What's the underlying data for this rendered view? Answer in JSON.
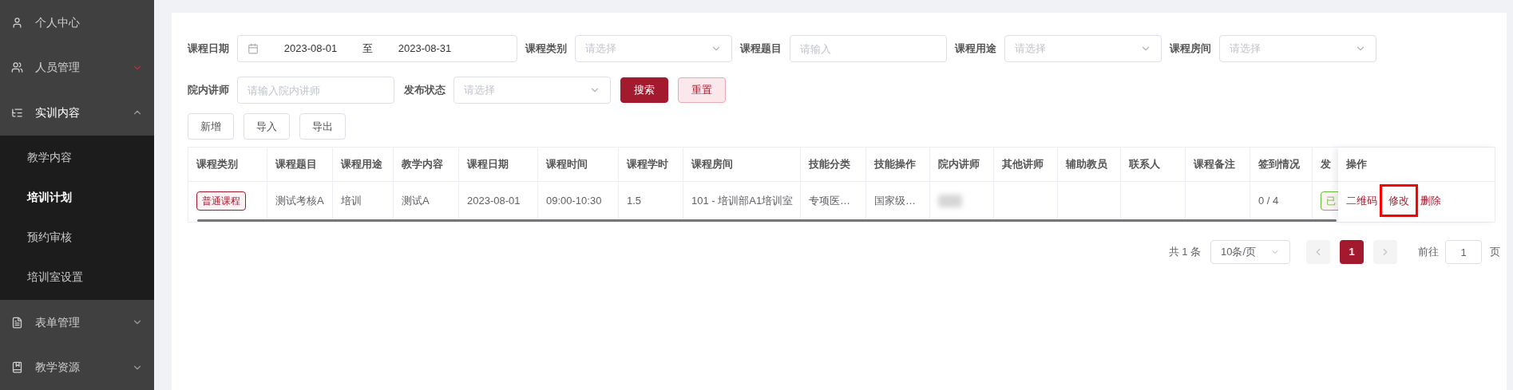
{
  "sidebar": {
    "items": [
      {
        "label": "个人中心"
      },
      {
        "label": "人员管理",
        "expanded": false,
        "hovered": true
      },
      {
        "label": "实训内容",
        "expanded": true,
        "hovered": false,
        "children": [
          {
            "label": "教学内容",
            "selected": false
          },
          {
            "label": "培训计划",
            "selected": true
          },
          {
            "label": "预约审核",
            "selected": false
          },
          {
            "label": "培训室设置",
            "selected": false
          }
        ]
      },
      {
        "label": "表单管理",
        "expanded": false,
        "hovered": false
      },
      {
        "label": "教学资源",
        "expanded": false,
        "hovered": false
      }
    ]
  },
  "filters": [
    {
      "kind": "date_range",
      "label": "课程日期",
      "start": "2023-08-01",
      "separator": "至",
      "end": "2023-08-31"
    },
    {
      "kind": "select",
      "label": "课程类别",
      "placeholder": "请选择"
    },
    {
      "kind": "input",
      "label": "课程题目",
      "placeholder": "请输入"
    },
    {
      "kind": "select",
      "label": "课程用途",
      "placeholder": "请选择"
    },
    {
      "kind": "select",
      "label": "课程房间",
      "placeholder": "请选择"
    },
    {
      "kind": "input",
      "label": "院内讲师",
      "placeholder": "请输入院内讲师"
    },
    {
      "kind": "select",
      "label": "发布状态",
      "placeholder": "请选择"
    }
  ],
  "filter_buttons": [
    {
      "label": "搜索",
      "kind": "primary"
    },
    {
      "label": "重置",
      "kind": "secondary"
    }
  ],
  "toolbar": [
    "新增",
    "导入",
    "导出"
  ],
  "table": {
    "columns": [
      "课程类别",
      "课程题目",
      "课程用途",
      "教学内容",
      "课程日期",
      "课程时间",
      "课程学时",
      "课程房间",
      "技能分类",
      "技能操作",
      "院内讲师",
      "其他讲师",
      "辅助教员",
      "联系人",
      "课程备注",
      "签到情况",
      "发"
    ],
    "actions_column": "操作",
    "rows": [
      {
        "cells": [
          {
            "kind": "tag",
            "text": "普通课程",
            "color": "#a31a2e"
          },
          {
            "kind": "text",
            "text": "测试考核A"
          },
          {
            "kind": "text",
            "text": "培训"
          },
          {
            "kind": "text",
            "text": "测试A"
          },
          {
            "kind": "text",
            "text": "2023-08-01"
          },
          {
            "kind": "text",
            "text": "09:00-10:30"
          },
          {
            "kind": "text",
            "text": "1.5"
          },
          {
            "kind": "text",
            "text": "101 - 培训部A1培训室"
          },
          {
            "kind": "text",
            "text": "专项医…"
          },
          {
            "kind": "text",
            "text": "国家级…"
          },
          {
            "kind": "redacted"
          },
          {
            "kind": "empty"
          },
          {
            "kind": "empty"
          },
          {
            "kind": "empty"
          },
          {
            "kind": "empty"
          },
          {
            "kind": "text",
            "text": "0 / 4"
          },
          {
            "kind": "tag",
            "text": "已",
            "color": "#67c23a"
          }
        ],
        "actions": [
          {
            "label": "二维码",
            "highlighted": false
          },
          {
            "label": "修改",
            "highlighted": true
          },
          {
            "label": "删除",
            "highlighted": false
          }
        ]
      }
    ]
  },
  "pagination": {
    "total": "共 1 条",
    "page_size": "10条/页",
    "prev_disabled": true,
    "pages": [
      {
        "label": "1",
        "selected": true
      }
    ],
    "next_disabled": true,
    "goto_label": "前往",
    "goto_value": "1",
    "goto_suffix": "页"
  }
}
